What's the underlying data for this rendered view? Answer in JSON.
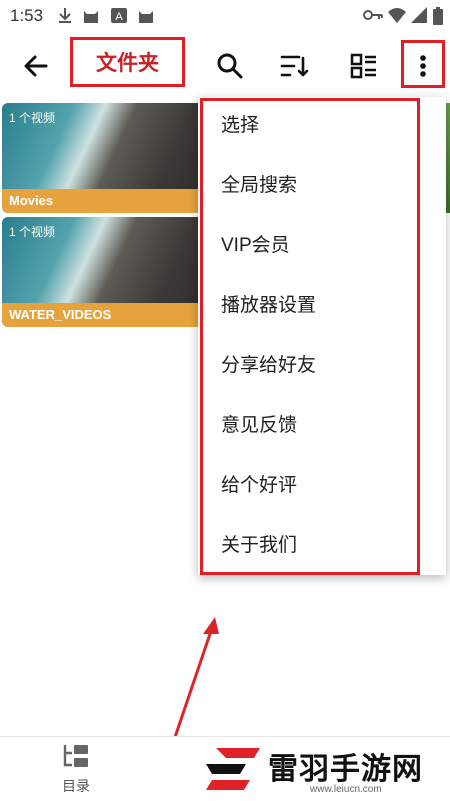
{
  "statusbar": {
    "time": "1:53"
  },
  "appbar": {
    "title": "文件夹",
    "back_icon": "arrow-left-icon",
    "search_icon": "search-icon",
    "sort_icon": "sort-icon",
    "view_icon": "list-view-icon",
    "more_icon": "more-vertical-icon"
  },
  "folders": [
    {
      "count": "1 个视频",
      "name": "Movies"
    },
    {
      "count": "1 个视频",
      "name": "WATER_VIDEOS"
    }
  ],
  "menu": {
    "items": [
      "选择",
      "全局搜索",
      "VIP会员",
      "播放器设置",
      "分享给好友",
      "意见反馈",
      "给个好评",
      "关于我们"
    ]
  },
  "bottom_nav": {
    "label": "目录"
  },
  "watermark": {
    "text": "雷羽手游网",
    "url": "www.leiucn.com"
  },
  "colors": {
    "highlight": "#e01f26",
    "folder_label": "#e6a33d",
    "accent": "#cc1f22"
  }
}
